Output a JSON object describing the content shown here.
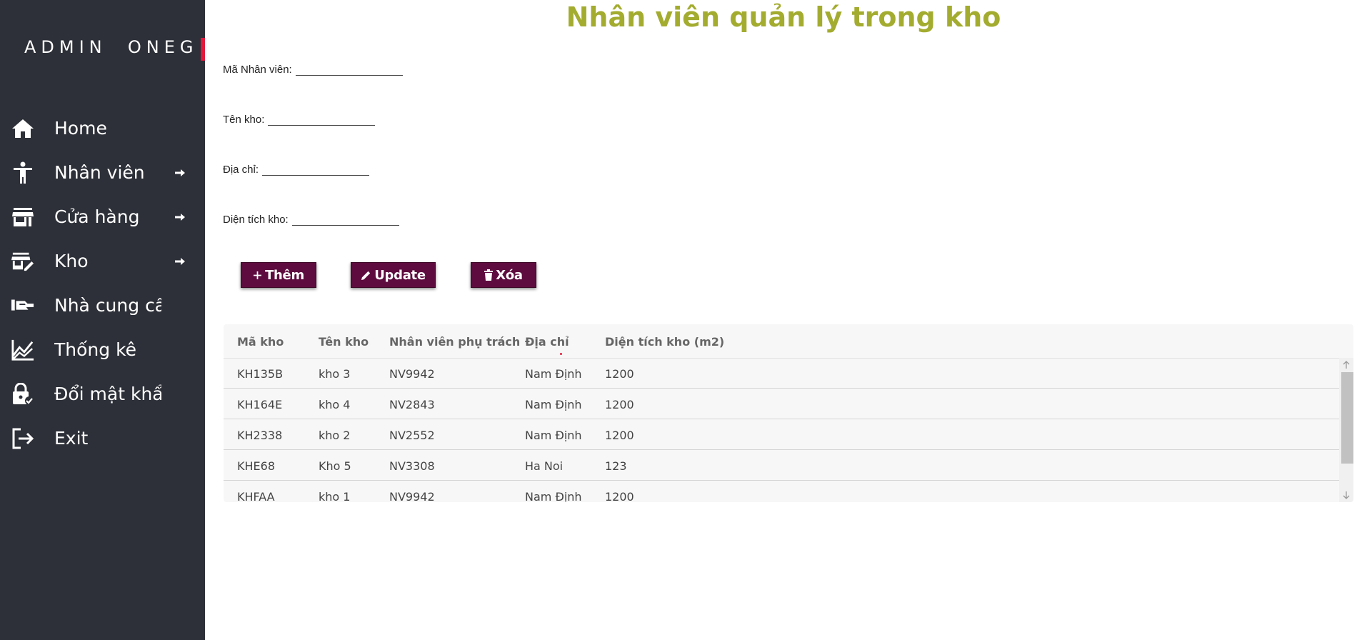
{
  "sidebar": {
    "brand": "ADMIN  ONEG",
    "items": [
      {
        "label": "Home",
        "icon": "home-icon"
      },
      {
        "label": "Nhân viên",
        "icon": "person-icon",
        "has_arrow": true
      },
      {
        "label": "Cửa hàng",
        "icon": "store-icon",
        "has_arrow": true
      },
      {
        "label": "Kho",
        "icon": "warehouse-edit-icon",
        "has_arrow": true
      },
      {
        "label": "Nhà cung cấp",
        "icon": "hand-supplier-icon"
      },
      {
        "label": "Thống kê",
        "icon": "chart-line-icon"
      },
      {
        "label": "Đổi mật khẩu",
        "icon": "lock-person-icon"
      },
      {
        "label": "Exit",
        "icon": "exit-icon"
      }
    ]
  },
  "main": {
    "title": "Nhân viên quản lý trong kho",
    "form": {
      "employee_id_label": "Mã Nhân viên:",
      "warehouse_name_label": "Tên kho:",
      "address_label": "Địa chỉ:",
      "area_label": "Diện tích kho:"
    },
    "buttons": {
      "add": "Thêm",
      "update": "Update",
      "delete": "Xóa"
    },
    "table": {
      "headers": [
        "Mã kho",
        "Tên kho",
        "Nhân viên phụ trách",
        "Địa chỉ",
        "Diện tích kho (m2)"
      ],
      "rows": [
        [
          "KH135B",
          "kho 3",
          "NV9942",
          "Nam Định",
          "1200"
        ],
        [
          "KH164E",
          "kho 4",
          "NV2843",
          "Nam Định",
          "1200"
        ],
        [
          "KH2338",
          "kho 2",
          "NV2552",
          "Nam Định",
          "1200"
        ],
        [
          "KHE68",
          "Kho 5",
          "NV3308",
          "Ha Noi",
          "123"
        ],
        [
          "KHFAA",
          "kho 1",
          "NV9942",
          "Nam Định",
          "1200"
        ]
      ]
    }
  },
  "colors": {
    "sidebar_bg": "#2d3038",
    "title": "#a3ac2f",
    "button_bg": "#5e0b3f",
    "brand_accent": "#e3193b"
  }
}
